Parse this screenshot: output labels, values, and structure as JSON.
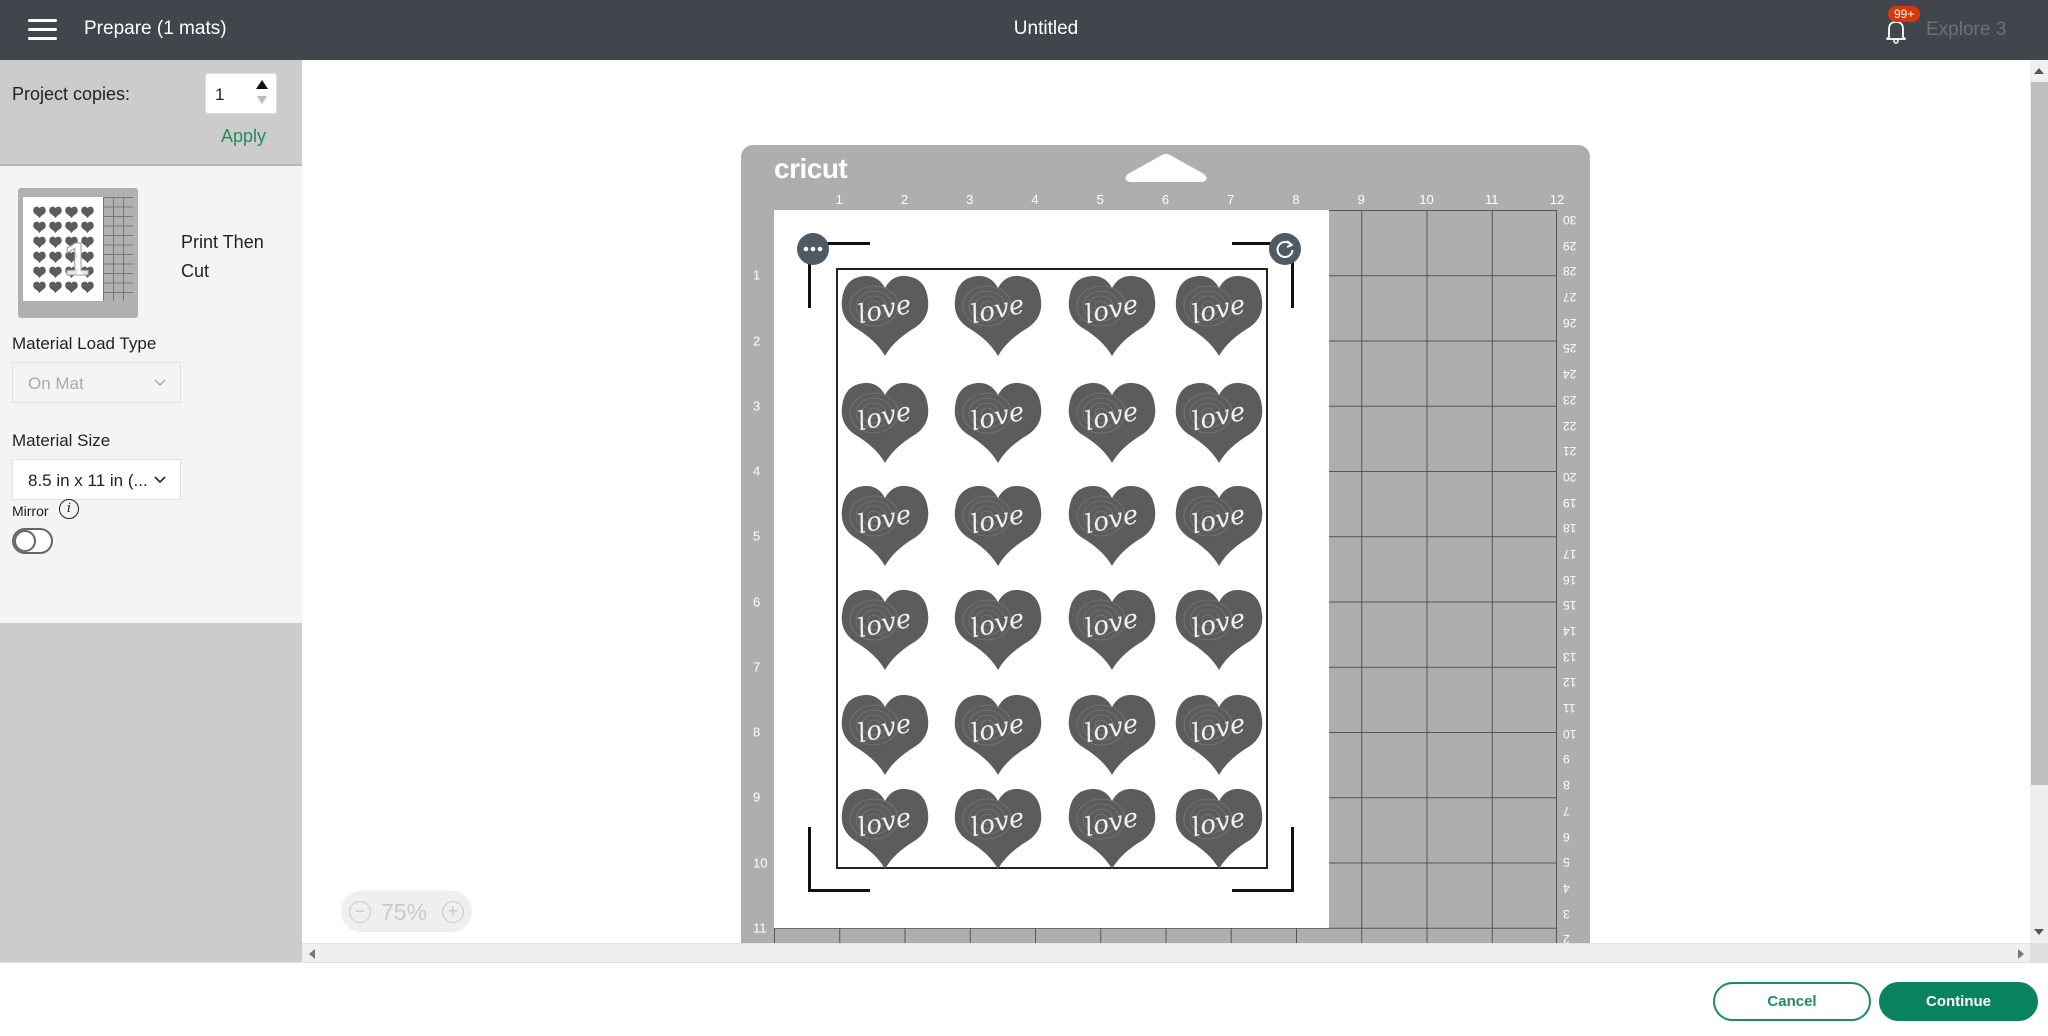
{
  "header": {
    "menu_icon": "hamburger-menu-icon",
    "prepare_label": "Prepare (1 mats)",
    "project_title": "Untitled",
    "notification_icon": "bell-icon",
    "notification_badge": "99+",
    "machine_name": "Explore 3"
  },
  "sidebar": {
    "project_copies_label": "Project copies:",
    "project_copies_value": "1",
    "apply_label": "Apply",
    "mat": {
      "thumbnail_number": "1",
      "type_label": "Print Then Cut"
    },
    "material_load_type_label": "Material Load Type",
    "material_load_type_value": "On Mat",
    "material_size_label": "Material Size",
    "material_size_value": "8.5 in x 11 in (...",
    "mirror_label": "Mirror",
    "mirror_info_icon": "i",
    "mirror_enabled": false
  },
  "mat_preview": {
    "brand_logo": "cricut",
    "top_ruler": [
      "1",
      "2",
      "3",
      "4",
      "5",
      "6",
      "7",
      "8",
      "9",
      "10",
      "11",
      "12"
    ],
    "left_ruler": [
      "1",
      "2",
      "3",
      "4",
      "5",
      "6",
      "7",
      "8",
      "9",
      "10",
      "11"
    ],
    "right_ruler_cm": [
      "30",
      "29",
      "28",
      "27",
      "26",
      "25",
      "24",
      "23",
      "22",
      "21",
      "20",
      "19",
      "18",
      "17",
      "16",
      "15",
      "14",
      "13",
      "12",
      "11",
      "10",
      "9",
      "8",
      "7",
      "6",
      "5",
      "4",
      "3",
      "2"
    ],
    "design": {
      "item_text": "love",
      "rows": 6,
      "columns": 4,
      "count": 24
    },
    "handles": {
      "more_icon": "more-options-icon",
      "rotate_icon": "rotate-icon"
    }
  },
  "zoom": {
    "value": "75%",
    "zoom_out_icon": "minus-circle-icon",
    "zoom_in_icon": "plus-circle-icon"
  },
  "footer": {
    "cancel_label": "Cancel",
    "continue_label": "Continue"
  },
  "colors": {
    "header_bg": "#41454c",
    "accent_green": "#0a8260",
    "badge_red": "#d9360b",
    "mat_gray": "#aeaeae"
  }
}
